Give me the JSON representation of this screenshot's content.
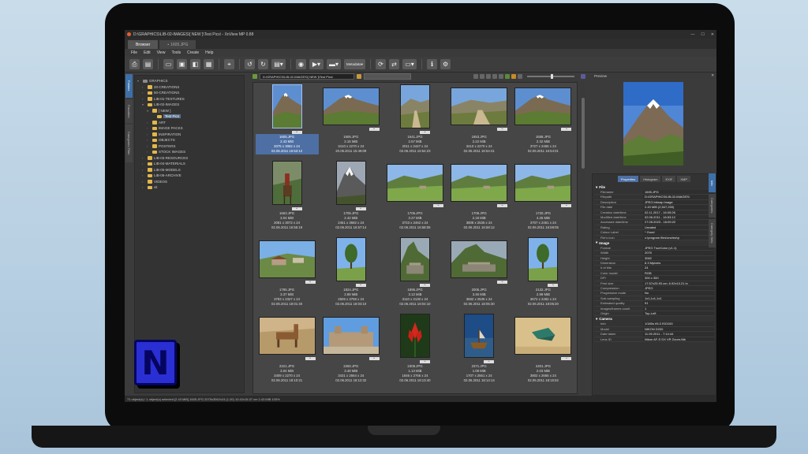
{
  "window": {
    "title": "D:\\GRAPHICS\\LIB-02-IMAGES\\[ NEW ]\\Test Pics\\ - XnView MP 0.88",
    "minimize": "—",
    "maximize": "☐",
    "close": "✕"
  },
  "tabs": [
    {
      "label": "Browser"
    },
    {
      "label": "1605.JPG"
    }
  ],
  "menu": [
    "File",
    "Edit",
    "View",
    "Tools",
    "Create",
    "Help"
  ],
  "toolbar": {
    "metadata_label": "Metadata"
  },
  "left_tabs": [
    "Folders",
    "Favorites",
    "Categories Filter"
  ],
  "folder_tree": [
    {
      "label": "GRAPHICS",
      "level": 0,
      "exp": "▾"
    },
    {
      "label": "20-CREATIONS",
      "level": 1,
      "exp": "›"
    },
    {
      "label": "50-CREATIONS",
      "level": 1,
      "exp": "›"
    },
    {
      "label": "LIB-01-TEXTURES",
      "level": 1,
      "exp": "›"
    },
    {
      "label": "LIB-02-IMAGES",
      "level": 1,
      "exp": "▾"
    },
    {
      "label": "[ NEW ]",
      "level": 2,
      "exp": "▾"
    },
    {
      "label": "Test Pics",
      "level": 3,
      "exp": "",
      "selected": true
    },
    {
      "label": "ART",
      "level": 2,
      "exp": "›"
    },
    {
      "label": "IMAGE PACKS",
      "level": 2,
      "exp": "›"
    },
    {
      "label": "INSPIRATION",
      "level": 2,
      "exp": "›"
    },
    {
      "label": "OBJECTS",
      "level": 2,
      "exp": "›"
    },
    {
      "label": "POSTERS",
      "level": 2,
      "exp": "›"
    },
    {
      "label": "STOCK IMAGES",
      "level": 2,
      "exp": "›"
    },
    {
      "label": "LIB-03-RESOURCES",
      "level": 1,
      "exp": "›"
    },
    {
      "label": "LIB-04-MATERIALS",
      "level": 1,
      "exp": "›"
    },
    {
      "label": "LIB-05-MODELS",
      "level": 1,
      "exp": "›"
    },
    {
      "label": "LIB-06-ARCHIVE",
      "level": 1,
      "exp": "›"
    },
    {
      "label": "VIDEOS",
      "level": 1,
      "exp": "›"
    },
    {
      "label": "vit",
      "level": 1,
      "exp": "›"
    }
  ],
  "address": "D:\\GRAPHICS\\LIB-02-IMAGES\\[ NEW ]\\Test Pics\\",
  "thumbnails": [
    {
      "name": "1605.JPG",
      "size": "2.43 MiB",
      "dims": "2075 x 3062 x 24",
      "date": "02.06.2011 16:53:12",
      "orient": "p",
      "selected": true,
      "scene": "mountain"
    },
    {
      "name": "1606.JPG",
      "size": "2.15 MiB",
      "dims": "3410 x 2270 x 24",
      "date": "20.05.2011 15:49:09",
      "orient": "l",
      "scene": "mountain"
    },
    {
      "name": "1641.JPG",
      "size": "2.57 MiB",
      "dims": "2011 x 3447 x 24",
      "date": "02.06.2011 16:54:23",
      "orient": "p",
      "scene": "road"
    },
    {
      "name": "1653.JPG",
      "size": "2.22 MiB",
      "dims": "3410 x 2270 x 24",
      "date": "02.06.2011 16:54:41",
      "orient": "l",
      "scene": "road"
    },
    {
      "name": "1658.JPG",
      "size": "2.32 MiB",
      "dims": "3727 x 2465 x 24",
      "date": "02.06.2011 16:54:01",
      "orient": "l",
      "scene": "mountain"
    },
    {
      "name": "1663.JPG",
      "size": "3.04 MiB",
      "dims": "2081 x 3072 x 24",
      "date": "02.06.2011 16:55:19",
      "orient": "p",
      "scene": "rider"
    },
    {
      "name": "1705.JPG",
      "size": "2.42 MiB",
      "dims": "2461 x 3682 x 24",
      "date": "02.06.2011 16:57:14",
      "orient": "p",
      "scene": "peak"
    },
    {
      "name": "1706.JPG",
      "size": "3.27 MiB",
      "dims": "3723 x 2462 x 24",
      "date": "02.06.2011 16:58:06",
      "orient": "l",
      "scene": "green"
    },
    {
      "name": "1708.JPG",
      "size": "2.18 MiB",
      "dims": "3808 x 2535 x 24",
      "date": "02.06.2011 16:58:12",
      "orient": "l",
      "scene": "green"
    },
    {
      "name": "1720.JPG",
      "size": "4.26 MiB",
      "dims": "3707 x 2451 x 24",
      "date": "02.06.2011 16:59:05",
      "orient": "l",
      "scene": "green"
    },
    {
      "name": "1795.JPG",
      "size": "3.37 MiB",
      "dims": "3783 x 2327 x 24",
      "date": "02.06.2011 18:01:40",
      "orient": "l",
      "scene": "house"
    },
    {
      "name": "1824.JPG",
      "size": "2.88 MiB",
      "dims": "2506 x 3759 x 24",
      "date": "02.06.2011 18:03:10",
      "orient": "p",
      "scene": "tree"
    },
    {
      "name": "1895.JPG",
      "size": "3.12 MiB",
      "dims": "3110 x 3130 x 24",
      "date": "02.06.2011 18:04:10",
      "orient": "p",
      "scene": "ruins"
    },
    {
      "name": "2005.JPG",
      "size": "3.46 MiB",
      "dims": "3682 x 2535 x 24",
      "date": "02.06.2011 18:05:30",
      "orient": "l",
      "scene": "ruins"
    },
    {
      "name": "2132.JPG",
      "size": "2.99 MiB",
      "dims": "3672 x 2492 x 24",
      "date": "02.06.2011 18:06:20",
      "orient": "p",
      "scene": "tree"
    },
    {
      "name": "2221.JPG",
      "size": "3.04 MiB",
      "dims": "3409 x 2270 x 24",
      "date": "02.06.2011 18:10:21",
      "orient": "l",
      "scene": "llama"
    },
    {
      "name": "2250.JPG",
      "size": "3.48 MiB",
      "dims": "3431 x 2564 x 24",
      "date": "02.06.2011 18:12:32",
      "orient": "l",
      "scene": "church"
    },
    {
      "name": "2308.JPG",
      "size": "1.13 MiB",
      "dims": "1846 x 2766 x 24",
      "date": "02.06.2011 18:13:40",
      "orient": "p",
      "scene": "flower"
    },
    {
      "name": "2371.JPG",
      "size": "1.08 MiB",
      "dims": "1707 x 2561 x 24",
      "date": "02.06.2011 18:14:14",
      "orient": "p",
      "scene": "boat"
    },
    {
      "name": "2401.JPG",
      "size": "2.03 MiB",
      "dims": "3802 x 2665 x 24",
      "date": "02.06.2011 18:15:52",
      "orient": "l",
      "scene": "sand"
    }
  ],
  "preview": {
    "title": "Preview"
  },
  "properties": {
    "tabs": [
      "Properties",
      "Histogram",
      "EXIF",
      "XMP"
    ],
    "side_tabs": [
      "Info",
      "Categories",
      "Category Sets"
    ],
    "sections": [
      {
        "title": "File",
        "rows": [
          [
            "Filename",
            "1605.JPG"
          ],
          [
            "Filepath",
            "D:\\GRAPHICS\\LIB-02-IMAGES\\"
          ],
          [
            "Description",
            "JPEG bitmap image"
          ],
          [
            "File date",
            "2.43 MiB (2,547,200)"
          ],
          [
            "Creation date/time",
            "02.11.2017 - 16:05:26"
          ],
          [
            "Modified date/time",
            "02.06.2011 - 16:53:12"
          ],
          [
            "Accessed date/time",
            "27.05.2023 - 16:09:22"
          ],
          [
            "Rating",
            "Unrated"
          ],
          [
            "Colour Label",
            "* Good"
          ],
          [
            "File's icon",
            "c:\\program files\\xnview\\p"
          ]
        ]
      },
      {
        "title": "Image",
        "rows": [
          [
            "Format",
            "JPEG TrueColor (v1.1)"
          ],
          [
            "Width",
            "2075"
          ],
          [
            "Height",
            "3062"
          ],
          [
            "Dimension",
            "6.3 Mpixels"
          ],
          [
            "# of bits",
            "24"
          ],
          [
            "Color model",
            "RGB"
          ],
          [
            "DPI",
            "300 x 300"
          ],
          [
            "Print size",
            "17.57x25.93 cm; 6.92x10.21 in"
          ],
          [
            "Compression",
            "JPEG"
          ],
          [
            "Progressive mode",
            "No"
          ],
          [
            "Sub-sampling",
            "1x1,1x1,1x1"
          ],
          [
            "Estimated quality",
            "91"
          ],
          [
            "Images/frames count",
            "1"
          ],
          [
            "Origin",
            "Top-Left"
          ]
        ]
      },
      {
        "title": "Camera",
        "rows": [
          [
            "Info",
            "1/180s f/6.3 ISO100"
          ],
          [
            "Model",
            "NIKON D200"
          ],
          [
            "Date taken",
            "11.05.2011 - 7:14:44"
          ],
          [
            "Lens ID",
            "Nikon AF-S DX VR Zoom-Nik"
          ]
        ]
      }
    ]
  },
  "status": "71 object(s) / 1 object(s) selected [2.43 MiB]   1605.JPG   2075x3062x24 (1.20)   10.42x15.37 cm   2.43 MiB   100%",
  "logo": {
    "letter": "N"
  }
}
